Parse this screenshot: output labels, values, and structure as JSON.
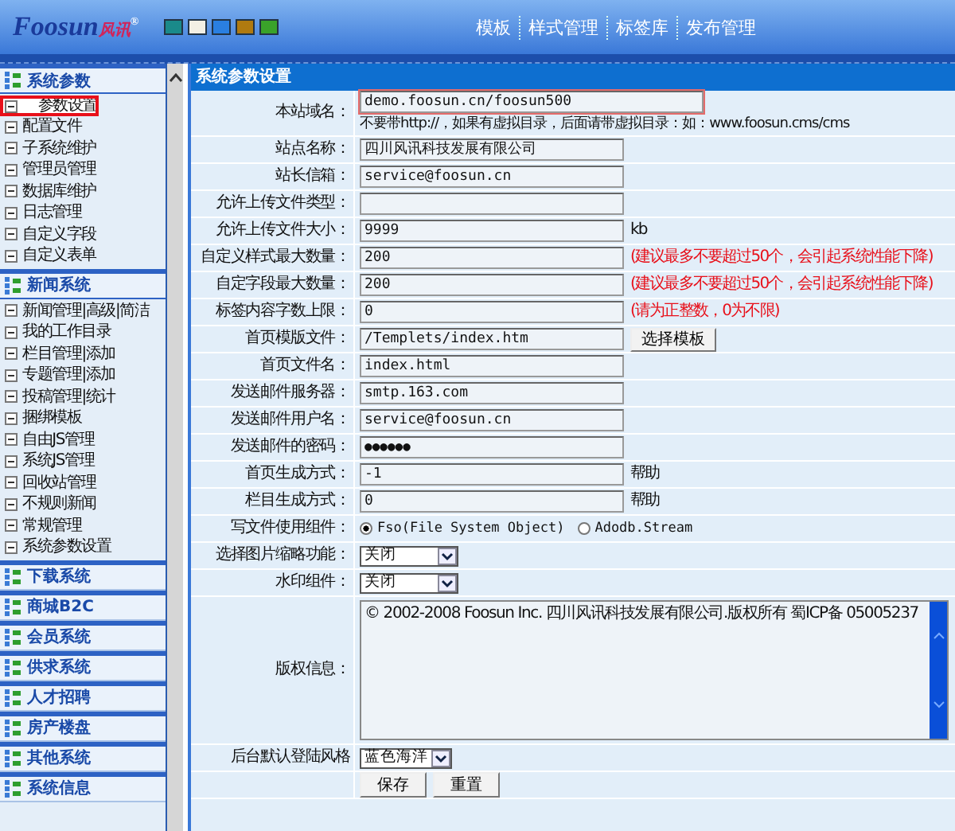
{
  "header": {
    "logo": "Foosun",
    "logo_cn": "风讯",
    "logo_mark": "®",
    "swatches": [
      {
        "color": "#1a8a8a"
      },
      {
        "color": "#f2efe4"
      },
      {
        "color": "#2a7fe0"
      },
      {
        "color": "#b07a10"
      },
      {
        "color": "#3aa22a"
      }
    ],
    "nav": [
      "模板",
      "样式管理",
      "标签库",
      "发布管理"
    ]
  },
  "sidebar": {
    "sections": [
      {
        "title": "系统参数",
        "expanded": true,
        "items": [
          {
            "label": "参数设置",
            "selected": true
          },
          {
            "label": "配置文件",
            "selected": false
          },
          {
            "label": "子系统维护",
            "selected": false
          },
          {
            "label": "管理员管理",
            "selected": false
          },
          {
            "label": "数据库维护",
            "selected": false
          },
          {
            "label": "日志管理",
            "selected": false
          },
          {
            "label": "自定义字段",
            "selected": false
          },
          {
            "label": "自定义表单",
            "selected": false
          }
        ]
      },
      {
        "title": "新闻系统",
        "expanded": true,
        "items": [
          {
            "label": "新闻管理|高级|简洁",
            "selected": false
          },
          {
            "label": "我的工作目录",
            "selected": false
          },
          {
            "label": "栏目管理|添加",
            "selected": false
          },
          {
            "label": "专题管理|添加",
            "selected": false
          },
          {
            "label": "投稿管理|统计",
            "selected": false
          },
          {
            "label": "捆绑模板",
            "selected": false
          },
          {
            "label": "自由JS管理",
            "selected": false
          },
          {
            "label": "系统JS管理",
            "selected": false
          },
          {
            "label": "回收站管理",
            "selected": false
          },
          {
            "label": "不规则新闻",
            "selected": false
          },
          {
            "label": "常规管理",
            "selected": false
          },
          {
            "label": "系统参数设置",
            "selected": false
          }
        ]
      },
      {
        "title": "下载系统",
        "expanded": false
      },
      {
        "title": "商城B2C",
        "expanded": false
      },
      {
        "title": "会员系统",
        "expanded": false
      },
      {
        "title": "供求系统",
        "expanded": false
      },
      {
        "title": "人才招聘",
        "expanded": false
      },
      {
        "title": "房产楼盘",
        "expanded": false
      },
      {
        "title": "其他系统",
        "expanded": false
      },
      {
        "title": "系统信息",
        "expanded": false
      }
    ]
  },
  "panel": {
    "title": "系统参数设置",
    "rows": [
      {
        "kind": "text",
        "label": "本站域名：",
        "value": "demo.foosun.cn/foosun500",
        "highlighted": true,
        "hint": "不要带http://，如果有虚拟目录，后面请带虚拟目录：如：www.foosun.cms/cms"
      },
      {
        "kind": "text",
        "label": "站点名称：",
        "value": "四川风讯科技发展有限公司"
      },
      {
        "kind": "text",
        "label": "站长信箱：",
        "value": "service@foosun.cn"
      },
      {
        "kind": "text",
        "label": "允许上传文件类型："
      },
      {
        "kind": "text",
        "label": "允许上传文件大小：",
        "value": "9999",
        "note": "kb",
        "warning": false
      },
      {
        "kind": "text",
        "label": "自定义样式最大数量：",
        "value": "200",
        "note": "(建议最多不要超过50个，会引起系统性能下降)",
        "warning": true
      },
      {
        "kind": "text",
        "label": "自定字段最大数量：",
        "value": "200",
        "note": "(建议最多不要超过50个，会引起系统性能下降)",
        "warning": true
      },
      {
        "kind": "text",
        "label": "标签内容字数上限：",
        "value": "0",
        "note": "(请为正整数，0为不限)",
        "warning": true
      },
      {
        "kind": "text",
        "label": "首页模版文件：",
        "value": "/Templets/index.htm",
        "button": "选择模板"
      },
      {
        "kind": "text",
        "label": "首页文件名：",
        "value": "index.html"
      },
      {
        "kind": "text",
        "label": "发送邮件服务器：",
        "value": "smtp.163.com"
      },
      {
        "kind": "text",
        "label": "发送邮件用户名：",
        "value": "service@foosun.cn"
      },
      {
        "kind": "password",
        "label": "发送邮件的密码：",
        "value": "●●●●●●"
      },
      {
        "kind": "text",
        "label": "首页生成方式：",
        "value": "-1",
        "note": "帮助",
        "warning": false
      },
      {
        "kind": "text",
        "label": "栏目生成方式：",
        "value": "0",
        "note": "帮助",
        "warning": false
      },
      {
        "kind": "radio",
        "label": "写文件使用组件：",
        "options": [
          {
            "label": "Fso(File System Object)",
            "selected": true
          },
          {
            "label": "Adodb.Stream",
            "selected": false
          }
        ]
      },
      {
        "kind": "select",
        "label": "选择图片缩略功能：",
        "value": "关闭"
      },
      {
        "kind": "select",
        "label": "水印组件：",
        "value": "关闭"
      },
      {
        "kind": "textarea",
        "label": "版权信息：",
        "value": "© 2002-2008 Foosun Inc. 四川风讯科技发展有限公司.版权所有 蜀ICP备 05005237"
      },
      {
        "kind": "select_small",
        "label": "后台默认登陆风格",
        "value": "蓝色海洋"
      },
      {
        "kind": "actions",
        "buttons": [
          "保存",
          "重置"
        ]
      }
    ]
  }
}
